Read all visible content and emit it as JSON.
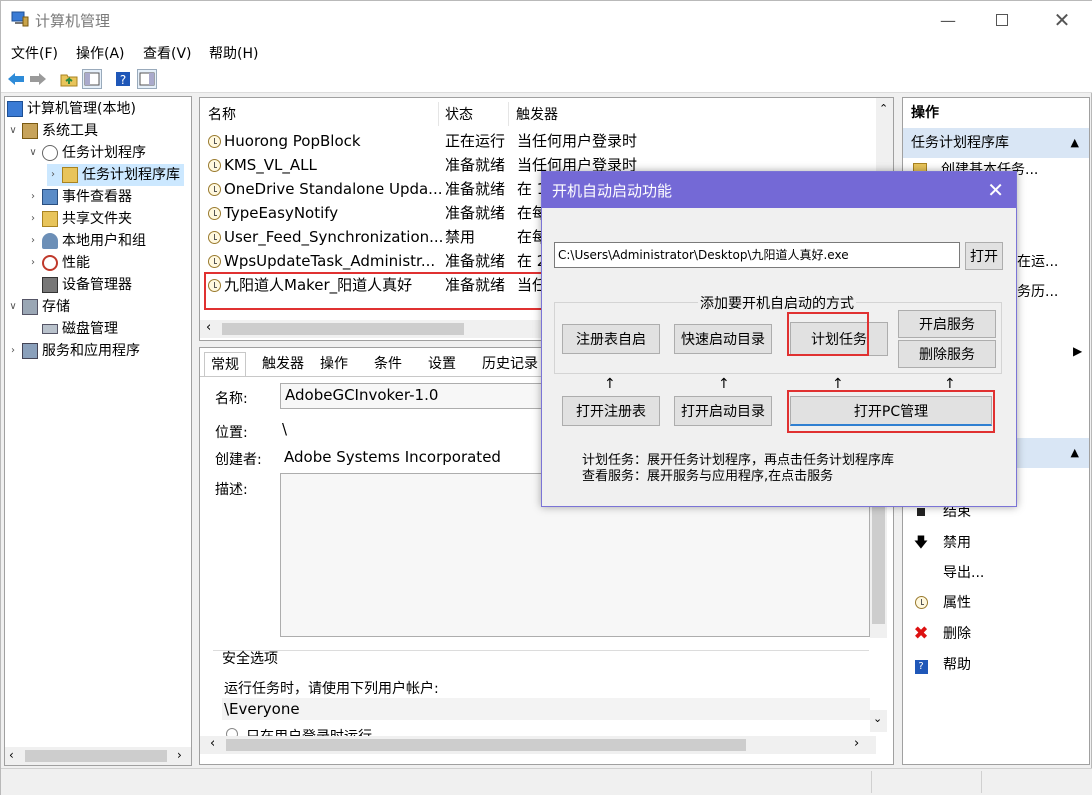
{
  "window": {
    "title": "计算机管理"
  },
  "menu": [
    "文件(F)",
    "操作(A)",
    "查看(V)",
    "帮助(H)"
  ],
  "tree": {
    "root": "计算机管理(本地)",
    "system_tools": "系统工具",
    "task_scheduler": "任务计划程序",
    "task_library": "任务计划程序库",
    "event_viewer": "事件查看器",
    "shared_folders": "共享文件夹",
    "local_users": "本地用户和组",
    "performance": "性能",
    "device_manager": "设备管理器",
    "storage": "存储",
    "disk_mgmt": "磁盘管理",
    "services_apps": "服务和应用程序"
  },
  "list": {
    "headers": {
      "name": "名称",
      "status": "状态",
      "trigger": "触发器"
    },
    "rows": [
      {
        "name": "Huorong PopBlock",
        "status": "正在运行",
        "trigger": "当任何用户登录时"
      },
      {
        "name": "KMS_VL_ALL",
        "status": "准备就绪",
        "trigger": "当任何用户登录时"
      },
      {
        "name": "OneDrive Standalone Upda...",
        "status": "准备就绪",
        "trigger": "在 1"
      },
      {
        "name": "TypeEasyNotify",
        "status": "准备就绪",
        "trigger": "在每"
      },
      {
        "name": "User_Feed_Synchronization...",
        "status": "禁用",
        "trigger": "在每"
      },
      {
        "name": "WpsUpdateTask_Administr...",
        "status": "准备就绪",
        "trigger": "在 2"
      },
      {
        "name": "九阳道人Maker_阳道人真好",
        "status": "准备就绪",
        "trigger": "当任"
      }
    ]
  },
  "detail": {
    "tabs": [
      "常规",
      "触发器",
      "操作",
      "条件",
      "设置",
      "历史记录"
    ],
    "name_label": "名称:",
    "name_value": "AdobeGCInvoker-1.0",
    "location_label": "位置:",
    "location_value": "\\",
    "author_label": "创建者:",
    "author_value": "Adobe Systems Incorporated",
    "desc_label": "描述:",
    "security_label": "安全选项",
    "run_as_label": "运行任务时，请使用下列用户帐户:",
    "run_as_value": "\\Everyone",
    "radio_label": "只在用户登录时运行"
  },
  "actions": {
    "header": "操作",
    "section1": "任务计划程序库",
    "items1": [
      {
        "label": "创建基本任务...",
        "icon": "create-task-icon"
      },
      {
        "label": "在运...",
        "icon": "none"
      },
      {
        "label": "务历...",
        "icon": "none"
      }
    ],
    "items2": [
      {
        "label": "结束",
        "icon": "stop-icon"
      },
      {
        "label": "禁用",
        "icon": "disable-icon"
      },
      {
        "label": "导出...",
        "icon": "none"
      },
      {
        "label": "属性",
        "icon": "properties-icon"
      },
      {
        "label": "删除",
        "icon": "delete-icon"
      },
      {
        "label": "帮助",
        "icon": "help-icon"
      }
    ]
  },
  "dialog": {
    "title": "开机自动启动功能",
    "path_value": "C:\\Users\\Administrator\\Desktop\\九阳道人真好.exe",
    "open_label": "打开",
    "group_label": "添加要开机自启动的方式",
    "btn_registry": "注册表自启",
    "btn_quick": "快速启动目录",
    "btn_schedule": "计划任务",
    "btn_start_service": "开启服务",
    "btn_delete_service": "删除服务",
    "btn_open_registry": "打开注册表",
    "btn_open_startup": "打开启动目录",
    "btn_open_pc": "打开PC管理",
    "arrow": "↑",
    "note1": "计划任务：展开任务计划程序，再点击任务计划程序库",
    "note2": "查看服务：展开服务与应用程序,在点击服务"
  },
  "colors": {
    "dialog_title": "#7469d6",
    "highlight": "#e03131",
    "selection": "#cce8ff"
  }
}
